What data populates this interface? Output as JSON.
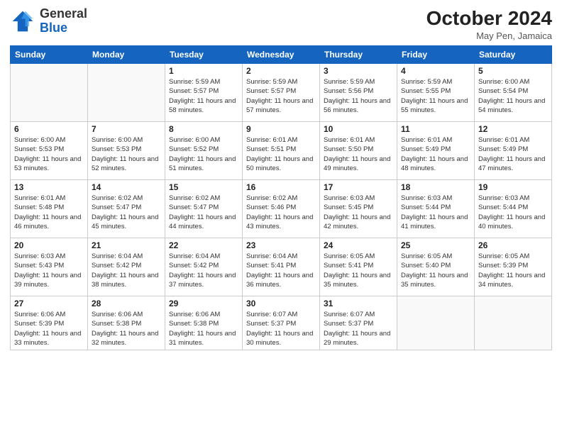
{
  "logo": {
    "general": "General",
    "blue": "Blue"
  },
  "header": {
    "month": "October 2024",
    "location": "May Pen, Jamaica"
  },
  "weekdays": [
    "Sunday",
    "Monday",
    "Tuesday",
    "Wednesday",
    "Thursday",
    "Friday",
    "Saturday"
  ],
  "weeks": [
    [
      {
        "day": "",
        "info": ""
      },
      {
        "day": "",
        "info": ""
      },
      {
        "day": "1",
        "info": "Sunrise: 5:59 AM\nSunset: 5:57 PM\nDaylight: 11 hours and 58 minutes."
      },
      {
        "day": "2",
        "info": "Sunrise: 5:59 AM\nSunset: 5:57 PM\nDaylight: 11 hours and 57 minutes."
      },
      {
        "day": "3",
        "info": "Sunrise: 5:59 AM\nSunset: 5:56 PM\nDaylight: 11 hours and 56 minutes."
      },
      {
        "day": "4",
        "info": "Sunrise: 5:59 AM\nSunset: 5:55 PM\nDaylight: 11 hours and 55 minutes."
      },
      {
        "day": "5",
        "info": "Sunrise: 6:00 AM\nSunset: 5:54 PM\nDaylight: 11 hours and 54 minutes."
      }
    ],
    [
      {
        "day": "6",
        "info": "Sunrise: 6:00 AM\nSunset: 5:53 PM\nDaylight: 11 hours and 53 minutes."
      },
      {
        "day": "7",
        "info": "Sunrise: 6:00 AM\nSunset: 5:53 PM\nDaylight: 11 hours and 52 minutes."
      },
      {
        "day": "8",
        "info": "Sunrise: 6:00 AM\nSunset: 5:52 PM\nDaylight: 11 hours and 51 minutes."
      },
      {
        "day": "9",
        "info": "Sunrise: 6:01 AM\nSunset: 5:51 PM\nDaylight: 11 hours and 50 minutes."
      },
      {
        "day": "10",
        "info": "Sunrise: 6:01 AM\nSunset: 5:50 PM\nDaylight: 11 hours and 49 minutes."
      },
      {
        "day": "11",
        "info": "Sunrise: 6:01 AM\nSunset: 5:49 PM\nDaylight: 11 hours and 48 minutes."
      },
      {
        "day": "12",
        "info": "Sunrise: 6:01 AM\nSunset: 5:49 PM\nDaylight: 11 hours and 47 minutes."
      }
    ],
    [
      {
        "day": "13",
        "info": "Sunrise: 6:01 AM\nSunset: 5:48 PM\nDaylight: 11 hours and 46 minutes."
      },
      {
        "day": "14",
        "info": "Sunrise: 6:02 AM\nSunset: 5:47 PM\nDaylight: 11 hours and 45 minutes."
      },
      {
        "day": "15",
        "info": "Sunrise: 6:02 AM\nSunset: 5:47 PM\nDaylight: 11 hours and 44 minutes."
      },
      {
        "day": "16",
        "info": "Sunrise: 6:02 AM\nSunset: 5:46 PM\nDaylight: 11 hours and 43 minutes."
      },
      {
        "day": "17",
        "info": "Sunrise: 6:03 AM\nSunset: 5:45 PM\nDaylight: 11 hours and 42 minutes."
      },
      {
        "day": "18",
        "info": "Sunrise: 6:03 AM\nSunset: 5:44 PM\nDaylight: 11 hours and 41 minutes."
      },
      {
        "day": "19",
        "info": "Sunrise: 6:03 AM\nSunset: 5:44 PM\nDaylight: 11 hours and 40 minutes."
      }
    ],
    [
      {
        "day": "20",
        "info": "Sunrise: 6:03 AM\nSunset: 5:43 PM\nDaylight: 11 hours and 39 minutes."
      },
      {
        "day": "21",
        "info": "Sunrise: 6:04 AM\nSunset: 5:42 PM\nDaylight: 11 hours and 38 minutes."
      },
      {
        "day": "22",
        "info": "Sunrise: 6:04 AM\nSunset: 5:42 PM\nDaylight: 11 hours and 37 minutes."
      },
      {
        "day": "23",
        "info": "Sunrise: 6:04 AM\nSunset: 5:41 PM\nDaylight: 11 hours and 36 minutes."
      },
      {
        "day": "24",
        "info": "Sunrise: 6:05 AM\nSunset: 5:41 PM\nDaylight: 11 hours and 35 minutes."
      },
      {
        "day": "25",
        "info": "Sunrise: 6:05 AM\nSunset: 5:40 PM\nDaylight: 11 hours and 35 minutes."
      },
      {
        "day": "26",
        "info": "Sunrise: 6:05 AM\nSunset: 5:39 PM\nDaylight: 11 hours and 34 minutes."
      }
    ],
    [
      {
        "day": "27",
        "info": "Sunrise: 6:06 AM\nSunset: 5:39 PM\nDaylight: 11 hours and 33 minutes."
      },
      {
        "day": "28",
        "info": "Sunrise: 6:06 AM\nSunset: 5:38 PM\nDaylight: 11 hours and 32 minutes."
      },
      {
        "day": "29",
        "info": "Sunrise: 6:06 AM\nSunset: 5:38 PM\nDaylight: 11 hours and 31 minutes."
      },
      {
        "day": "30",
        "info": "Sunrise: 6:07 AM\nSunset: 5:37 PM\nDaylight: 11 hours and 30 minutes."
      },
      {
        "day": "31",
        "info": "Sunrise: 6:07 AM\nSunset: 5:37 PM\nDaylight: 11 hours and 29 minutes."
      },
      {
        "day": "",
        "info": ""
      },
      {
        "day": "",
        "info": ""
      }
    ]
  ]
}
